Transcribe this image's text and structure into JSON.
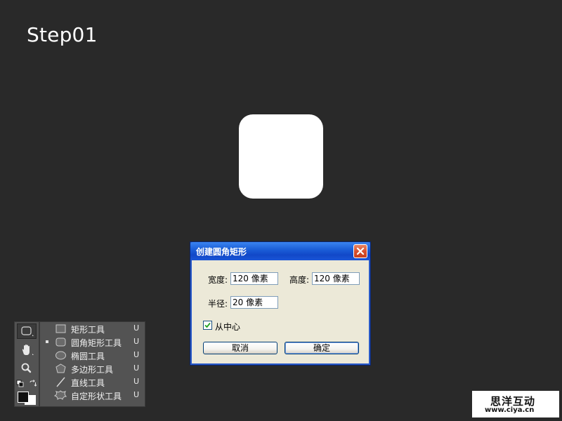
{
  "step_label": "Step01",
  "colors": {
    "background": "#292929",
    "shape_fill": "#ffffff",
    "titlebar": "#1c5fd8",
    "dialog_face": "#ece9d8",
    "panel": "#535353"
  },
  "dialog": {
    "title": "创建圆角矩形",
    "close_icon": "close-x",
    "width_label": "宽度:",
    "width_value": "120 像素",
    "height_label": "高度:",
    "height_value": "120 像素",
    "radius_label": "半径:",
    "radius_value": "20 像素",
    "from_center_label": "从中心",
    "from_center_checked": true,
    "cancel_label": "取消",
    "ok_label": "确定"
  },
  "tools": {
    "strip": [
      "rounded-rectangle-tool-icon",
      "hand-icon",
      "zoom-icon",
      "swap-colors-icon",
      "color-swatches-icon"
    ],
    "flyout": [
      {
        "label": "矩形工具",
        "key": "U",
        "icon": "rectangle-icon",
        "selected": false
      },
      {
        "label": "圆角矩形工具",
        "key": "U",
        "icon": "rounded-rectangle-icon",
        "selected": true
      },
      {
        "label": "椭圆工具",
        "key": "U",
        "icon": "ellipse-icon",
        "selected": false
      },
      {
        "label": "多边形工具",
        "key": "U",
        "icon": "polygon-icon",
        "selected": false
      },
      {
        "label": "直线工具",
        "key": "U",
        "icon": "line-icon",
        "selected": false
      },
      {
        "label": "自定形状工具",
        "key": "U",
        "icon": "custom-shape-icon",
        "selected": false
      }
    ]
  },
  "watermark": {
    "name": "思洋互动",
    "url": "www.ciya.cn"
  }
}
